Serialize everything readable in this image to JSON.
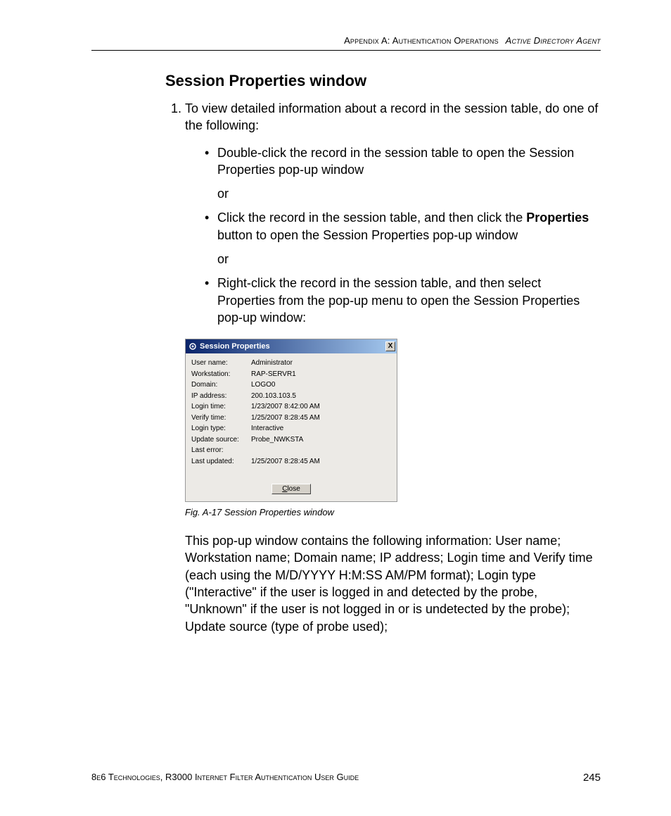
{
  "header": {
    "part1": "Appendix A: Authentication Operations",
    "part2": "Active Directory Agent"
  },
  "section_title": "Session Properties window",
  "step1_intro": "To view detailed information about a record in the session table, do one of the following:",
  "bullet1": "Double-click the record in the session table to open the Session Properties pop-up window",
  "or": "or",
  "bullet2_pre": "Click the record in the session table, and then click the ",
  "bullet2_bold": "Properties",
  "bullet2_post": " button to open the Session Properties pop-up window",
  "bullet3": "Right-click the record in the session table, and then select Properties from the pop-up menu to open the Session Properties pop-up window:",
  "dialog": {
    "title": "Session Properties",
    "close_x": "X",
    "rows": [
      {
        "label": "User name:",
        "value": "Administrator"
      },
      {
        "label": "Workstation:",
        "value": "RAP-SERVR1"
      },
      {
        "label": "Domain:",
        "value": "LOGO0"
      },
      {
        "label": "IP address:",
        "value": "200.103.103.5"
      },
      {
        "label": "Login time:",
        "value": "1/23/2007 8:42:00 AM"
      },
      {
        "label": "Verify time:",
        "value": "1/25/2007 8:28:45 AM"
      },
      {
        "label": "Login type:",
        "value": "Interactive"
      },
      {
        "label": "Update source:",
        "value": "Probe_NWKSTA"
      },
      {
        "label": "Last error:",
        "value": ""
      },
      {
        "label": "Last updated:",
        "value": "1/25/2007 8:28:45 AM"
      }
    ],
    "close_btn_u": "C",
    "close_btn_rest": "lose"
  },
  "caption": "Fig. A-17  Session Properties window",
  "body_para": "This pop-up window contains the following information: User name; Workstation name; Domain name; IP address; Login time and Verify time (each using the M/D/YYYY H:M:SS AM/PM format); Login type (\"Interactive\" if the user is logged in and detected by the probe, \"Unknown\" if the user is not logged in or is undetected by the probe); Update source (type of probe used);",
  "footer": {
    "text": "8e6 Technologies, R3000 Internet Filter Authentication User Guide",
    "page": "245"
  }
}
